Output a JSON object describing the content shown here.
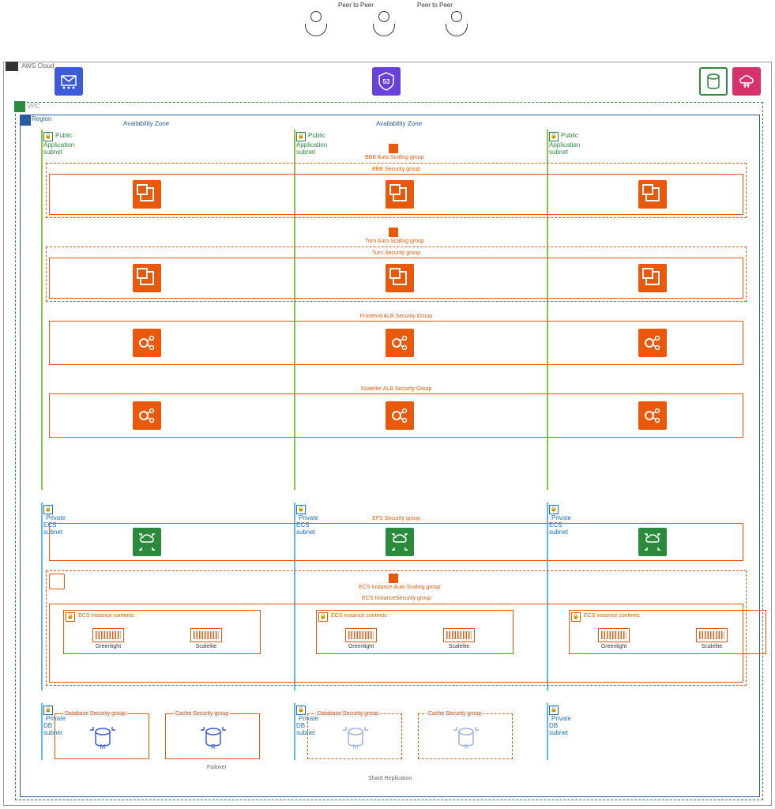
{
  "peer_to_peer": "Peer to Peer",
  "aws_cloud": "AWS Cloud",
  "vpc": "VPC",
  "region": "Region",
  "az": "Availability Zone",
  "subnets": {
    "public_app": "Public Application subnet",
    "private_ecs": "Private ECS subnet",
    "private_db": "Private DB subnet"
  },
  "groups": {
    "bbb_asg": "BBB Auto Scaling group",
    "bbb_sg": "BBB Security group",
    "turn_asg": "Turn Auto Scaling group",
    "turn_sg": "Turn Security group",
    "frontend_alb_sg": "Frontend ALB Security Group",
    "scalelite_alb_sg": "Scalelite ALB Security Group",
    "efs_sg": "EFS Security group",
    "ecs_asg": "ECS Instance Auto Scaling group",
    "ecs_sg": "ECS InstanceSecurity group",
    "ecs_contents": "ECS instance contents",
    "db_sg": "Database Security group",
    "cache_sg": "Cache Security group"
  },
  "containers": {
    "greenlight": "Greenlight",
    "scalelite": "Scalelite"
  },
  "db_letters": {
    "m": "M",
    "r": "R"
  },
  "failover": "Failover",
  "shard_replication": "Shard Replication",
  "icons": {
    "ses": "ses-icon",
    "route53": "route53-icon",
    "s3": "s3-icon",
    "cloudfront": "cloudfront-icon",
    "ec2": "ec2-icon",
    "alb": "alb-icon",
    "efs": "efs-icon",
    "ecs": "ecs-icon",
    "container": "container-icon",
    "rds": "rds-icon",
    "elasticache": "elasticache-icon",
    "user": "user-icon"
  }
}
